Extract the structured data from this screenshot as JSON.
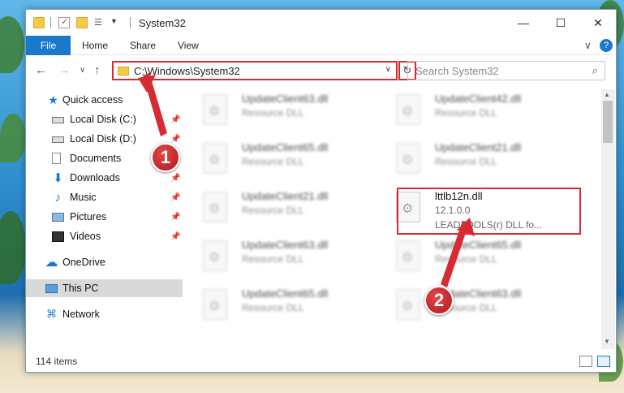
{
  "window": {
    "title": "System32",
    "controls": {
      "minimize": "—",
      "maximize": "☐",
      "close": "✕"
    }
  },
  "ribbon": {
    "file": "File",
    "tabs": [
      "Home",
      "Share",
      "View"
    ],
    "collapse": "∨",
    "help": "?"
  },
  "navigation": {
    "back": "←",
    "forward": "→",
    "recent": "∨",
    "up": "↑",
    "address": "C:\\Windows\\System32",
    "address_dropdown": "∨",
    "refresh": "↻",
    "search_placeholder": "Search System32"
  },
  "sidebar": {
    "items": [
      {
        "label": "Quick access",
        "icon": "star-icon",
        "pinned": false
      },
      {
        "label": "Local Disk (C:)",
        "icon": "drive-icon",
        "pinned": true
      },
      {
        "label": "Local Disk (D:)",
        "icon": "drive-icon",
        "pinned": true
      },
      {
        "label": "Documents",
        "icon": "document-icon",
        "pinned": true
      },
      {
        "label": "Downloads",
        "icon": "download-icon",
        "pinned": true
      },
      {
        "label": "Music",
        "icon": "music-icon",
        "pinned": true
      },
      {
        "label": "Pictures",
        "icon": "pictures-icon",
        "pinned": true
      },
      {
        "label": "Videos",
        "icon": "video-icon",
        "pinned": true
      },
      {
        "label": "OneDrive",
        "icon": "cloud-icon",
        "pinned": false
      },
      {
        "label": "This PC",
        "icon": "pc-icon",
        "pinned": false,
        "selected": true
      },
      {
        "label": "Network",
        "icon": "network-icon",
        "pinned": false
      }
    ]
  },
  "files": [
    {
      "name": "UpdateClient63.dll",
      "type": "Resource DLL",
      "blurred": true
    },
    {
      "name": "UpdateClient42.dll",
      "type": "Resource DLL",
      "blurred": true
    },
    {
      "name": "UpdateClient65.dll",
      "type": "Resource DLL",
      "blurred": true
    },
    {
      "name": "UpdateClient21.dll",
      "type": "Resource DLL",
      "blurred": true
    },
    {
      "name": "UpdateClient21.dll",
      "type": "Resource DLL",
      "blurred": true
    },
    {
      "name": "lttlb12n.dll",
      "type": "12.1.0.0",
      "description": "LEADTOOLS(r) DLL fo...",
      "blurred": false
    },
    {
      "name": "UpdateClient63.dll",
      "type": "Resource DLL",
      "blurred": true
    },
    {
      "name": "UpdateClient65.dll",
      "type": "Resource DLL",
      "blurred": true
    },
    {
      "name": "UpdateClient65.dll",
      "type": "Resource DLL",
      "blurred": true
    },
    {
      "name": "UpdateClient63.dll",
      "type": "Resource DLL",
      "blurred": true
    }
  ],
  "status": {
    "item_count": "114 items"
  },
  "annotations": {
    "badge1": "1",
    "badge2": "2",
    "accent_color": "#d62b33"
  }
}
